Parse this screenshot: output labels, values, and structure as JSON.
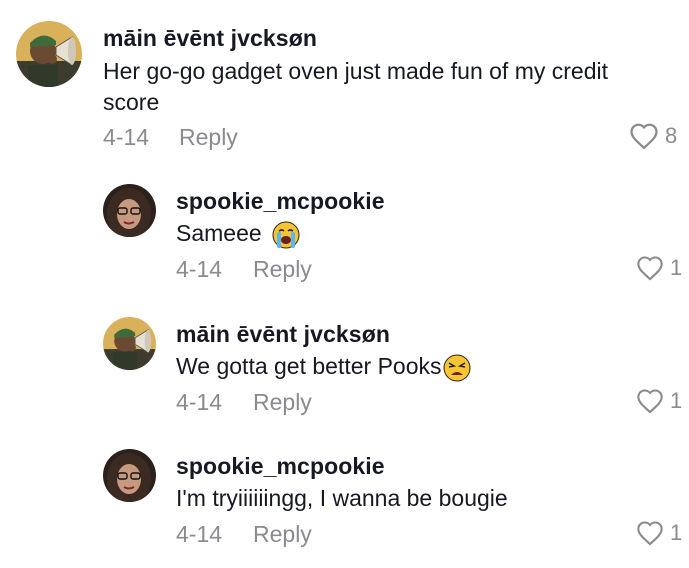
{
  "comments": [
    {
      "username": "māin ēvēnt jvcksøn",
      "text": "Her go-go gadget oven just made fun of my credit score",
      "date": "4-14",
      "reply_label": "Reply",
      "likes": "8",
      "avatar": "man-megaphone-avatar"
    },
    {
      "username": "spookie_mcpookie",
      "text": "Sameee",
      "emoji": "loudly-crying-face-icon",
      "date": "4-14",
      "reply_label": "Reply",
      "likes": "1",
      "avatar": "woman-glasses-avatar"
    },
    {
      "username": "māin ēvēnt jvcksøn",
      "text": "We gotta get better Pooks",
      "emoji": "weary-face-icon",
      "date": "4-14",
      "reply_label": "Reply",
      "likes": "1",
      "avatar": "man-megaphone-avatar"
    },
    {
      "username": "spookie_mcpookie",
      "text": "I'm tryiiiiiingg, I wanna be bougie",
      "date": "4-14",
      "reply_label": "Reply",
      "likes": "1",
      "avatar": "woman-glasses-avatar"
    }
  ]
}
